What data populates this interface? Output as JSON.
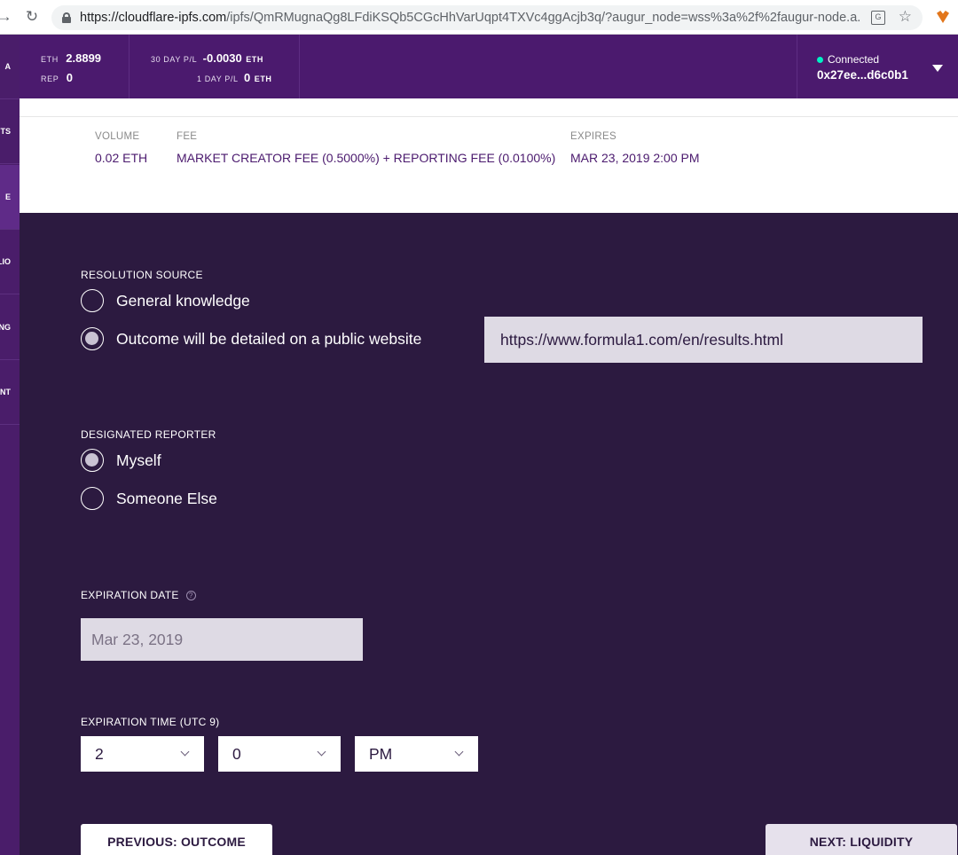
{
  "browser": {
    "url_host": "https://cloudflare-ipfs.com",
    "url_path": "/ipfs/QmRMugnaQg8LFdiKSQb5CGcHhVarUqpt4TXVc4ggAcjb3q/?augur_node=wss%3a%2f%2faugur-node.a..."
  },
  "sidebar": {
    "items": [
      {
        "label": "A"
      },
      {
        "label": "TS"
      },
      {
        "label": "E"
      },
      {
        "label": "LIO"
      },
      {
        "label": "NG"
      },
      {
        "label": "NT"
      }
    ]
  },
  "header": {
    "eth_label": "ETH",
    "eth_value": "2.8899",
    "rep_label": "REP",
    "rep_value": "0",
    "pl30_label": "30 DAY P/L",
    "pl30_value": "-0.0030",
    "pl30_unit": "ETH",
    "pl1_label": "1 DAY P/L",
    "pl1_value": "0",
    "pl1_unit": "ETH",
    "connection_status": "Connected",
    "account": "0x27ee...d6c0b1"
  },
  "summary": {
    "volume_label": "VOLUME",
    "volume_value": "0.02 ETH",
    "fee_label": "FEE",
    "fee_value": "MARKET CREATOR FEE (0.5000%) + REPORTING FEE (0.0100%)",
    "expires_label": "EXPIRES",
    "expires_value": "MAR 23, 2019 2:00 PM"
  },
  "form": {
    "resolution_source_label": "RESOLUTION SOURCE",
    "resolution_options": [
      "General knowledge",
      "Outcome will be detailed on a public website"
    ],
    "resolution_selected": 1,
    "resolution_url": "https://www.formula1.com/en/results.html",
    "designated_reporter_label": "DESIGNATED REPORTER",
    "reporter_options": [
      "Myself",
      "Someone Else"
    ],
    "reporter_selected": 0,
    "expiration_date_label": "EXPIRATION DATE",
    "expiration_date_value": "Mar 23, 2019",
    "expiration_time_label": "EXPIRATION TIME (UTC 9)",
    "hour": "2",
    "minute": "0",
    "meridiem": "PM",
    "prev_button": "PREVIOUS: OUTCOME",
    "next_button": "NEXT: LIQUIDITY"
  },
  "colors": {
    "header_purple": "#4b1a6e",
    "page_background": "#2c1a40",
    "connected_green": "#00f1c4"
  }
}
